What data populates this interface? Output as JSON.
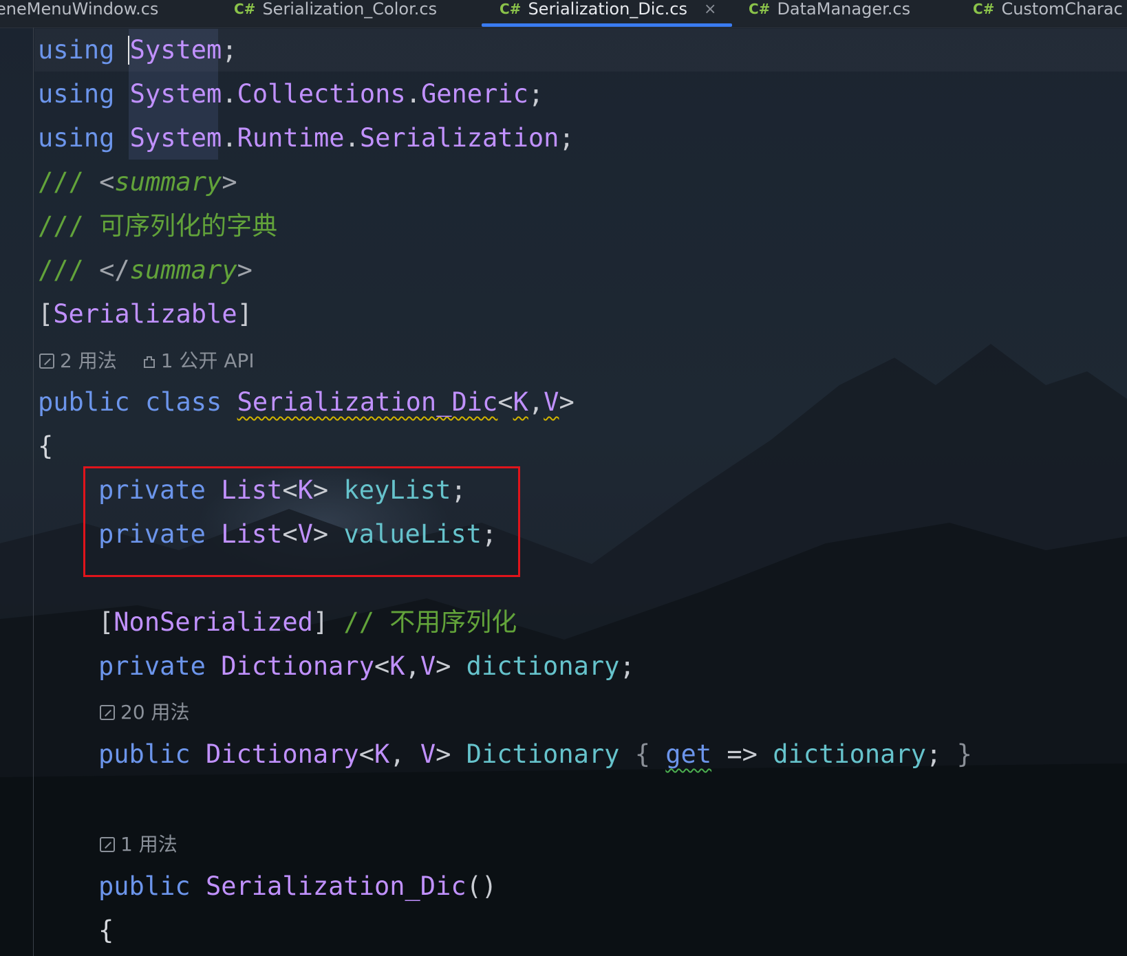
{
  "tabs": [
    {
      "label": "eneMenuWindow.cs",
      "prefix": ""
    },
    {
      "label": "Serialization_Color.cs",
      "prefix": "C#"
    },
    {
      "label": "Serialization_Dic.cs",
      "prefix": "C#",
      "active": true,
      "close": "×"
    },
    {
      "label": "DataManager.cs",
      "prefix": "C#"
    },
    {
      "label": "CustomCharac",
      "prefix": "C#"
    }
  ],
  "code": {
    "l1": {
      "kw": "using",
      "ns": "System",
      "end": ";"
    },
    "l2": {
      "kw": "using",
      "ns": "System",
      "dot1": ".",
      "p2": "Collections",
      "dot2": ".",
      "p3": "Generic",
      "end": ";"
    },
    "l3": {
      "kw": "using",
      "ns": "System",
      "dot1": ".",
      "p2": "Runtime",
      "dot2": ".",
      "p3": "Serialization",
      "end": ";"
    },
    "l4": {
      "slashes": "///",
      "open": "<",
      "tag": "summary",
      "close": ">"
    },
    "l5": {
      "slashes": "///",
      "text": "可序列化的字典"
    },
    "l6": {
      "slashes": "///",
      "open": "</",
      "tag": "summary",
      "close": ">"
    },
    "l7": {
      "lb": "[",
      "attr": "Serializable",
      "rb": "]"
    },
    "hint1": {
      "usages": "2 用法",
      "api": "1 公开 API"
    },
    "l8": {
      "kw1": "public",
      "kw2": "class",
      "name": "Serialization_Dic",
      "lt": "<",
      "k": "K",
      "comma": ",",
      "v": "V",
      "gt": ">"
    },
    "l9": {
      "brace": "{"
    },
    "l10": {
      "kw": "private",
      "type": "List",
      "lt": "<",
      "k": "K",
      "gt": ">",
      "field": "keyList",
      "end": ";"
    },
    "l11": {
      "kw": "private",
      "type": "List",
      "lt": "<",
      "v": "V",
      "gt": ">",
      "field": "valueList",
      "end": ";"
    },
    "l12": {
      "lb": "[",
      "attr": "NonSerialized",
      "rb": "]",
      "comment": "// 不用序列化"
    },
    "l13": {
      "kw": "private",
      "type": "Dictionary",
      "lt": "<",
      "k": "K",
      "comma": ",",
      "v": "V",
      "gt": ">",
      "field": "dictionary",
      "end": ";"
    },
    "hint2": {
      "usages": "20 用法"
    },
    "l14": {
      "kw": "public",
      "type": "Dictionary",
      "lt": "<",
      "k": "K",
      "comma": ", ",
      "v": "V",
      "gt": ">",
      "prop": "Dictionary",
      "ob": "{",
      "get": "get",
      "arrow": "=>",
      "field": "dictionary",
      "end": ";",
      "cb": "}"
    },
    "hint3": {
      "usages": "1 用法"
    },
    "l15": {
      "kw": "public",
      "name": "Serialization_Dic",
      "parens": "()"
    },
    "l16": {
      "brace": "{"
    }
  },
  "colors": {
    "keyword": "#6c95eb",
    "type": "#c191ff",
    "field": "#66c3cc",
    "comment": "#62a33a",
    "highlight_box": "#e0141b",
    "active_tab_underline": "#3a7bf0"
  }
}
